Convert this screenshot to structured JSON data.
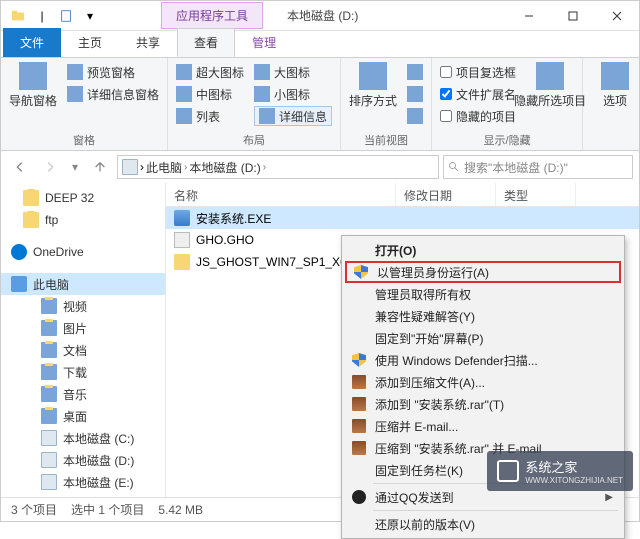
{
  "window": {
    "context_tab": "应用程序工具",
    "title": "本地磁盘 (D:)"
  },
  "tabs": {
    "file": "文件",
    "home": "主页",
    "share": "共享",
    "view": "查看",
    "manage": "管理"
  },
  "ribbon": {
    "panes": {
      "nav_pane": "导航窗格",
      "preview_pane": "预览窗格",
      "detail_pane": "详细信息窗格",
      "group": "窗格"
    },
    "layout": {
      "extra_large": "超大图标",
      "large": "大图标",
      "medium": "中图标",
      "small": "小图标",
      "list": "列表",
      "details": "详细信息",
      "group": "布局"
    },
    "current": {
      "sort": "排序方式",
      "group": "当前视图"
    },
    "showhide": {
      "checkboxes": "项目复选框",
      "extensions": "文件扩展名",
      "hidden_items": "隐藏的项目",
      "hide": "隐藏所选项目",
      "group": "显示/隐藏"
    },
    "options": "选项"
  },
  "address": {
    "this_pc": "此电脑",
    "drive": "本地磁盘 (D:)"
  },
  "search": {
    "placeholder": "搜索\"本地磁盘 (D:)\""
  },
  "tree": {
    "deep32": "DEEP 32",
    "ftp": "ftp",
    "onedrive": "OneDrive",
    "this_pc": "此电脑",
    "videos": "视频",
    "pictures": "图片",
    "documents": "文档",
    "downloads": "下载",
    "music": "音乐",
    "desktop": "桌面",
    "drive_c": "本地磁盘 (C:)",
    "drive_d": "本地磁盘 (D:)",
    "drive_e": "本地磁盘 (E:)"
  },
  "list": {
    "col_name": "名称",
    "col_date": "修改日期",
    "col_type": "类型",
    "items": [
      {
        "name": "安装系统.EXE"
      },
      {
        "name": "GHO.GHO"
      },
      {
        "name": "JS_GHOST_WIN7_SP1_X64_..."
      }
    ]
  },
  "context_menu": {
    "open": "打开(O)",
    "run_as_admin": "以管理员身份运行(A)",
    "take_ownership": "管理员取得所有权",
    "troubleshoot": "兼容性疑难解答(Y)",
    "pin_start": "固定到\"开始\"屏幕(P)",
    "defender": "使用 Windows Defender扫描...",
    "add_to_archive": "添加到压缩文件(A)...",
    "add_to_rar": "添加到 \"安装系统.rar\"(T)",
    "compress_email": "压缩并 E-mail...",
    "compress_to_email": "压缩到 \"安装系统.rar\" 并 E-mail",
    "pin_taskbar": "固定到任务栏(K)",
    "qq_send": "通过QQ发送到",
    "restore_prev": "还原以前的版本(V)"
  },
  "statusbar": {
    "count": "3 个项目",
    "selection": "选中 1 个项目",
    "size": "5.42 MB"
  },
  "watermark": {
    "text": "系统之家",
    "url": "WWW.XITONGZHIJIA.NET"
  }
}
